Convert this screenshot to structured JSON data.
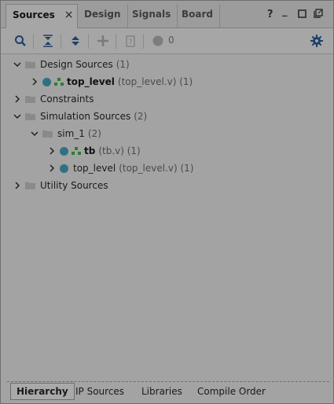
{
  "tabs": [
    {
      "label": "Sources",
      "active": true
    },
    {
      "label": "Design"
    },
    {
      "label": "Signals"
    },
    {
      "label": "Board"
    }
  ],
  "window_controls": {
    "help": "?",
    "minimize": "_"
  },
  "toolbar": {
    "status_count": "0"
  },
  "tree": {
    "design_sources": {
      "label": "Design Sources",
      "count": "(1)"
    },
    "ds_top": {
      "label": "top_level",
      "detail": "(top_level.v) (1)"
    },
    "constraints": {
      "label": "Constraints"
    },
    "sim_sources": {
      "label": "Simulation Sources",
      "count": "(2)"
    },
    "sim_1": {
      "label": "sim_1",
      "count": "(2)"
    },
    "tb": {
      "label": "tb",
      "detail": "(tb.v) (1)"
    },
    "sim_top": {
      "label": "top_level",
      "detail": "(top_level.v) (1)"
    },
    "utility": {
      "label": "Utility Sources"
    }
  },
  "bottom_tabs": [
    {
      "label": "Hierarchy",
      "active": true
    },
    {
      "label": "IP Sources"
    },
    {
      "label": "Libraries"
    },
    {
      "label": "Compile Order"
    }
  ],
  "colors": {
    "accent": "#2f5f9a",
    "dot": "#2f7184",
    "hier": "#2e7d32"
  }
}
